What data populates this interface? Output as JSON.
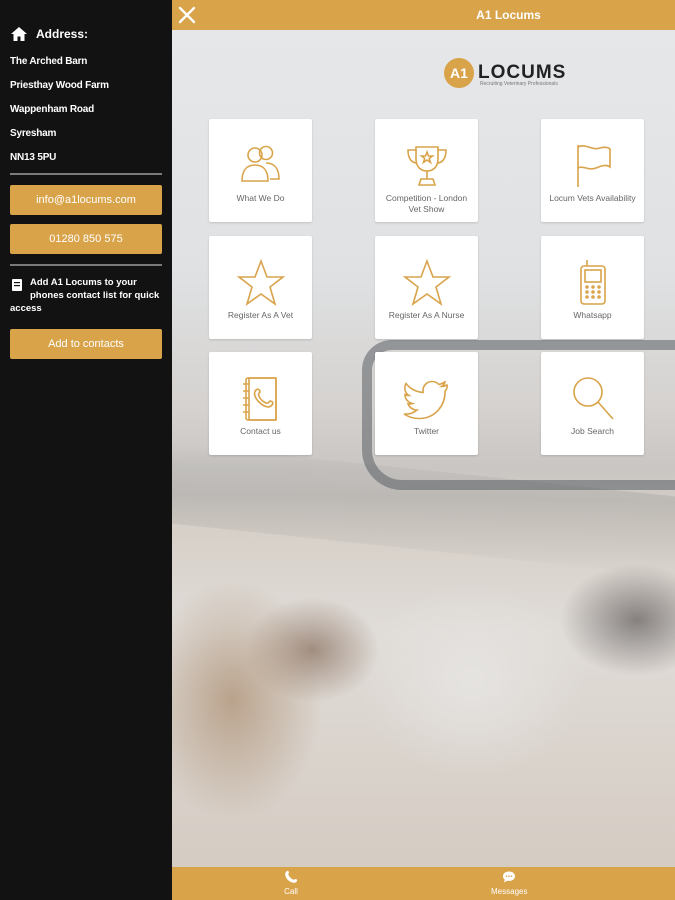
{
  "sidebar": {
    "address_heading": "Address:",
    "address_lines": [
      "The Arched Barn",
      "Priesthay Wood Farm",
      "Wappenham Road",
      "Syresham",
      "NN13 5PU"
    ],
    "email_button": "info@a1locums.com",
    "phone_button": "01280 850 575",
    "contact_note": "Add A1 Locums to your phones contact list for quick access",
    "add_contacts_button": "Add to contacts"
  },
  "topbar": {
    "title": "A1 Locums"
  },
  "logo": {
    "mark": "A1",
    "text": "LOCUMS",
    "tagline": "Recruiting Veterinary Professionals"
  },
  "tiles": [
    {
      "label": "What We Do",
      "icon": "people-icon"
    },
    {
      "label": "Competition - London Vet Show",
      "icon": "trophy-icon"
    },
    {
      "label": "Locum Vets Availability",
      "icon": "flag-icon"
    },
    {
      "label": "Register As A Vet",
      "icon": "star-icon"
    },
    {
      "label": "Register As A Nurse",
      "icon": "star-icon"
    },
    {
      "label": "Whatsapp",
      "icon": "mobile-phone-icon"
    },
    {
      "label": "Contact us",
      "icon": "address-book-icon"
    },
    {
      "label": "Twitter",
      "icon": "twitter-bird-icon"
    },
    {
      "label": "Job Search",
      "icon": "magnifier-icon"
    }
  ],
  "bottombar": {
    "call_label": "Call",
    "messages_label": "Messages"
  },
  "colors": {
    "accent": "#d9a34a",
    "sidebar_bg": "#121212",
    "icon_gold": "#d9a34a"
  }
}
